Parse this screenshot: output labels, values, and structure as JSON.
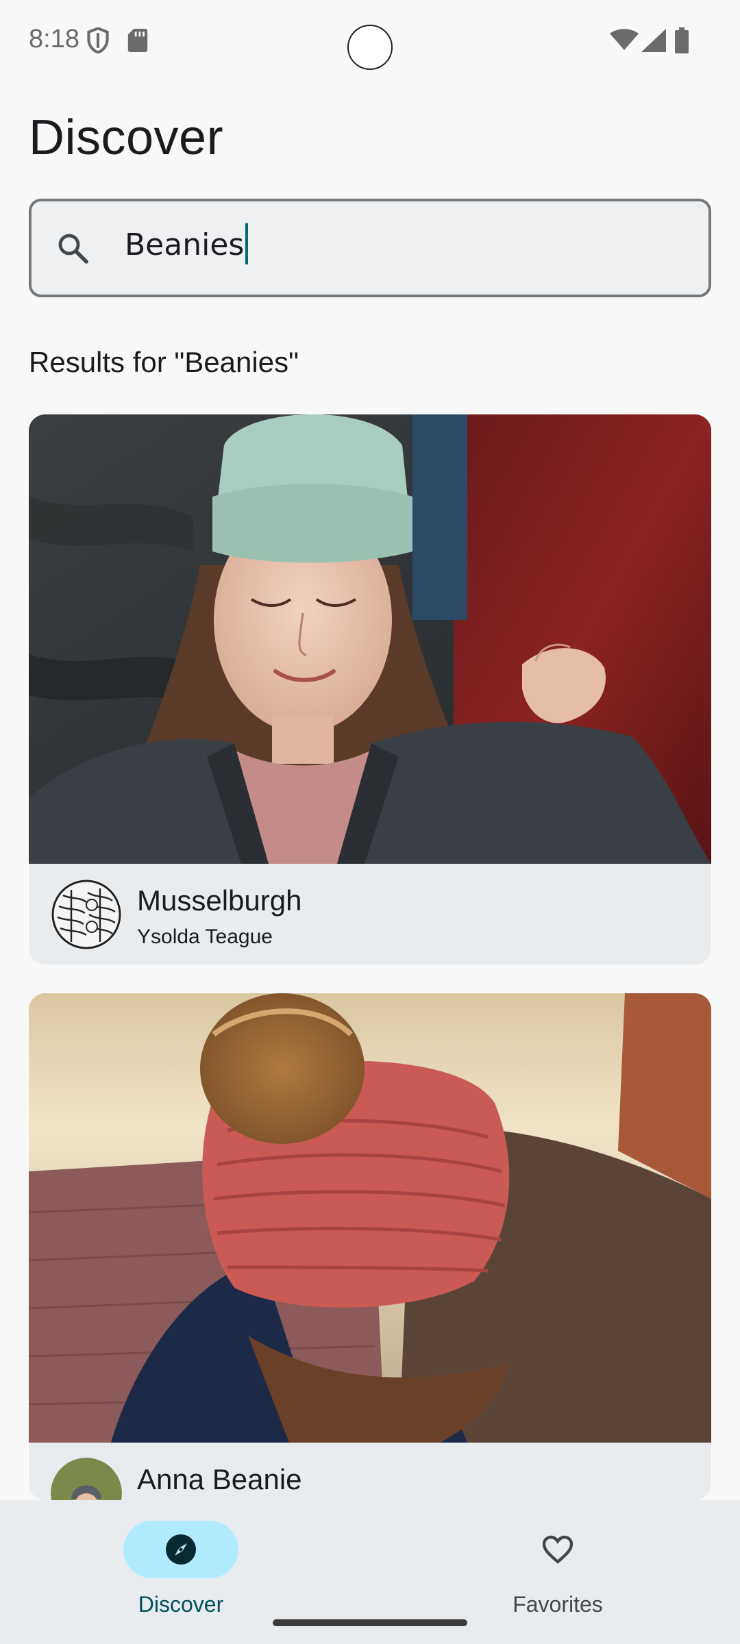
{
  "status_bar": {
    "time": "8:18",
    "icons": [
      "shield-icon",
      "sd-card-icon",
      "wifi-icon",
      "cell-signal-icon",
      "battery-icon"
    ]
  },
  "page": {
    "title": "Discover"
  },
  "search": {
    "value": "Beanies",
    "icon": "search-icon"
  },
  "results": {
    "label": "Results for \"Beanies\"",
    "items": [
      {
        "title": "Musselburgh",
        "author": "Ysolda Teague"
      },
      {
        "title": "Anna Beanie",
        "author": ""
      }
    ]
  },
  "bottom_nav": {
    "items": [
      {
        "label": "Discover",
        "icon": "compass-icon",
        "active": true
      },
      {
        "label": "Favorites",
        "icon": "heart-icon",
        "active": false
      }
    ]
  },
  "colors": {
    "accent": "#006a77",
    "active_pill": "#b1ebff",
    "nav_background": "#e8ecef"
  }
}
